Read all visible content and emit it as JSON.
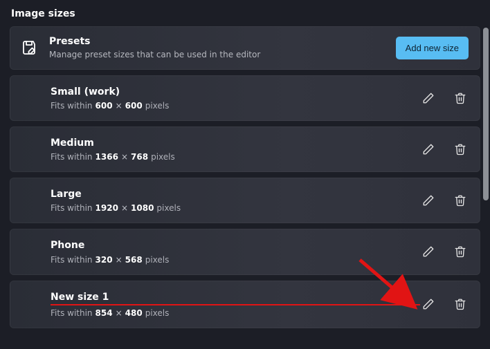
{
  "section_title": "Image sizes",
  "presets": {
    "title": "Presets",
    "subtitle": "Manage preset sizes that can be used in the editor",
    "button": "Add new size"
  },
  "dim_prefix": "Fits within",
  "dim_suffix": "pixels",
  "dim_sep": "×",
  "sizes": [
    {
      "name": "Small (work)",
      "w": "600",
      "h": "600",
      "highlight": false
    },
    {
      "name": "Medium",
      "w": "1366",
      "h": "768",
      "highlight": false
    },
    {
      "name": "Large",
      "w": "1920",
      "h": "1080",
      "highlight": false
    },
    {
      "name": "Phone",
      "w": "320",
      "h": "568",
      "highlight": false
    },
    {
      "name": "New size 1",
      "w": "854",
      "h": "480",
      "highlight": true
    }
  ]
}
